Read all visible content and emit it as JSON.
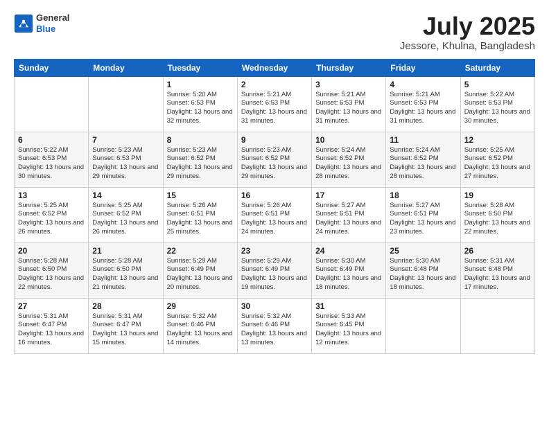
{
  "header": {
    "logo_general": "General",
    "logo_blue": "Blue",
    "month_title": "July 2025",
    "subtitle": "Jessore, Khulna, Bangladesh"
  },
  "weekdays": [
    "Sunday",
    "Monday",
    "Tuesday",
    "Wednesday",
    "Thursday",
    "Friday",
    "Saturday"
  ],
  "rows": [
    [
      {
        "day": "",
        "info": ""
      },
      {
        "day": "",
        "info": ""
      },
      {
        "day": "1",
        "info": "Sunrise: 5:20 AM\nSunset: 6:53 PM\nDaylight: 13 hours and 32 minutes."
      },
      {
        "day": "2",
        "info": "Sunrise: 5:21 AM\nSunset: 6:53 PM\nDaylight: 13 hours and 31 minutes."
      },
      {
        "day": "3",
        "info": "Sunrise: 5:21 AM\nSunset: 6:53 PM\nDaylight: 13 hours and 31 minutes."
      },
      {
        "day": "4",
        "info": "Sunrise: 5:21 AM\nSunset: 6:53 PM\nDaylight: 13 hours and 31 minutes."
      },
      {
        "day": "5",
        "info": "Sunrise: 5:22 AM\nSunset: 6:53 PM\nDaylight: 13 hours and 30 minutes."
      }
    ],
    [
      {
        "day": "6",
        "info": "Sunrise: 5:22 AM\nSunset: 6:53 PM\nDaylight: 13 hours and 30 minutes."
      },
      {
        "day": "7",
        "info": "Sunrise: 5:23 AM\nSunset: 6:53 PM\nDaylight: 13 hours and 29 minutes."
      },
      {
        "day": "8",
        "info": "Sunrise: 5:23 AM\nSunset: 6:52 PM\nDaylight: 13 hours and 29 minutes."
      },
      {
        "day": "9",
        "info": "Sunrise: 5:23 AM\nSunset: 6:52 PM\nDaylight: 13 hours and 29 minutes."
      },
      {
        "day": "10",
        "info": "Sunrise: 5:24 AM\nSunset: 6:52 PM\nDaylight: 13 hours and 28 minutes."
      },
      {
        "day": "11",
        "info": "Sunrise: 5:24 AM\nSunset: 6:52 PM\nDaylight: 13 hours and 28 minutes."
      },
      {
        "day": "12",
        "info": "Sunrise: 5:25 AM\nSunset: 6:52 PM\nDaylight: 13 hours and 27 minutes."
      }
    ],
    [
      {
        "day": "13",
        "info": "Sunrise: 5:25 AM\nSunset: 6:52 PM\nDaylight: 13 hours and 26 minutes."
      },
      {
        "day": "14",
        "info": "Sunrise: 5:25 AM\nSunset: 6:52 PM\nDaylight: 13 hours and 26 minutes."
      },
      {
        "day": "15",
        "info": "Sunrise: 5:26 AM\nSunset: 6:51 PM\nDaylight: 13 hours and 25 minutes."
      },
      {
        "day": "16",
        "info": "Sunrise: 5:26 AM\nSunset: 6:51 PM\nDaylight: 13 hours and 24 minutes."
      },
      {
        "day": "17",
        "info": "Sunrise: 5:27 AM\nSunset: 6:51 PM\nDaylight: 13 hours and 24 minutes."
      },
      {
        "day": "18",
        "info": "Sunrise: 5:27 AM\nSunset: 6:51 PM\nDaylight: 13 hours and 23 minutes."
      },
      {
        "day": "19",
        "info": "Sunrise: 5:28 AM\nSunset: 6:50 PM\nDaylight: 13 hours and 22 minutes."
      }
    ],
    [
      {
        "day": "20",
        "info": "Sunrise: 5:28 AM\nSunset: 6:50 PM\nDaylight: 13 hours and 22 minutes."
      },
      {
        "day": "21",
        "info": "Sunrise: 5:28 AM\nSunset: 6:50 PM\nDaylight: 13 hours and 21 minutes."
      },
      {
        "day": "22",
        "info": "Sunrise: 5:29 AM\nSunset: 6:49 PM\nDaylight: 13 hours and 20 minutes."
      },
      {
        "day": "23",
        "info": "Sunrise: 5:29 AM\nSunset: 6:49 PM\nDaylight: 13 hours and 19 minutes."
      },
      {
        "day": "24",
        "info": "Sunrise: 5:30 AM\nSunset: 6:49 PM\nDaylight: 13 hours and 18 minutes."
      },
      {
        "day": "25",
        "info": "Sunrise: 5:30 AM\nSunset: 6:48 PM\nDaylight: 13 hours and 18 minutes."
      },
      {
        "day": "26",
        "info": "Sunrise: 5:31 AM\nSunset: 6:48 PM\nDaylight: 13 hours and 17 minutes."
      }
    ],
    [
      {
        "day": "27",
        "info": "Sunrise: 5:31 AM\nSunset: 6:47 PM\nDaylight: 13 hours and 16 minutes."
      },
      {
        "day": "28",
        "info": "Sunrise: 5:31 AM\nSunset: 6:47 PM\nDaylight: 13 hours and 15 minutes."
      },
      {
        "day": "29",
        "info": "Sunrise: 5:32 AM\nSunset: 6:46 PM\nDaylight: 13 hours and 14 minutes."
      },
      {
        "day": "30",
        "info": "Sunrise: 5:32 AM\nSunset: 6:46 PM\nDaylight: 13 hours and 13 minutes."
      },
      {
        "day": "31",
        "info": "Sunrise: 5:33 AM\nSunset: 6:45 PM\nDaylight: 13 hours and 12 minutes."
      },
      {
        "day": "",
        "info": ""
      },
      {
        "day": "",
        "info": ""
      }
    ]
  ]
}
